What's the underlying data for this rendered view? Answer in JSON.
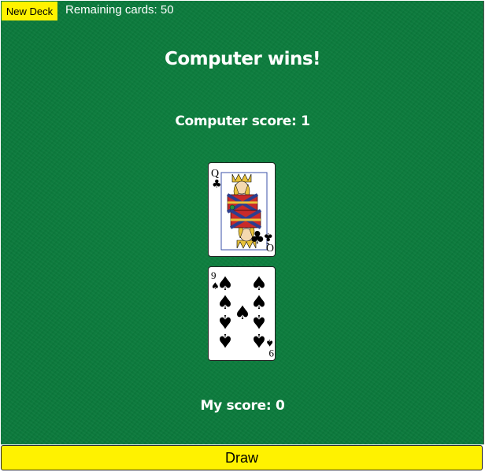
{
  "header": {
    "new_deck_label": "New Deck",
    "remaining_text": "Remaining cards: 50"
  },
  "game": {
    "result_text": "Computer wins!",
    "computer_score_text": "Computer score: 1",
    "my_score_text": "My score: 0"
  },
  "cards": {
    "computer": {
      "rank": "Q",
      "suit": "clubs",
      "suit_symbol": "♣",
      "color": "#000000"
    },
    "player": {
      "rank": "9",
      "suit": "spades",
      "suit_symbol": "♠",
      "color": "#000000"
    }
  },
  "controls": {
    "draw_label": "Draw"
  },
  "colors": {
    "table_felt": "#0b7a3c",
    "button_yellow": "#fff200",
    "text_white": "#ffffff"
  }
}
